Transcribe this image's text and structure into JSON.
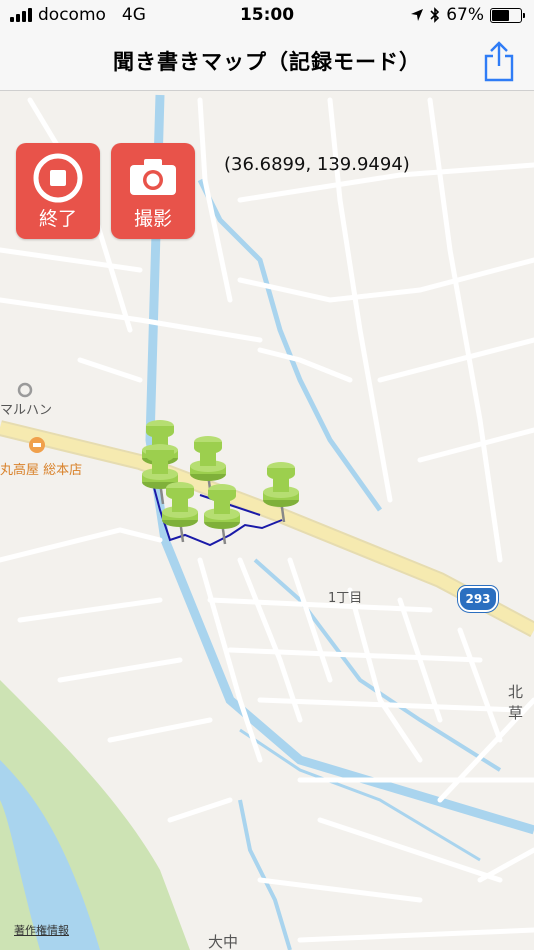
{
  "status_bar": {
    "carrier": "docomo",
    "network": "4G",
    "time": "15:00",
    "battery": "67%",
    "battery_level": 0.67,
    "icons": [
      "signal-icon",
      "location-arrow-icon",
      "bluetooth-icon",
      "battery-icon"
    ]
  },
  "nav": {
    "title": "聞き書きマップ（記録モード）",
    "share_icon": "share-icon"
  },
  "controls": {
    "stop_label": "終了",
    "stop_icon": "stop-icon",
    "photo_label": "撮影",
    "photo_icon": "camera-icon"
  },
  "map": {
    "coordinates": "(36.6899, 139.9494)",
    "labels": {
      "poi_maruhan": "マルハン",
      "poi_marutakaya": "丸高屋 総本店",
      "area_1chome": "1丁目",
      "area_kita": "北草",
      "area_onaka": "大中"
    },
    "route_number": "293",
    "attribution": "著作権情報",
    "pin_count": 6,
    "colors": {
      "accent_button": "#e8534a",
      "pin_green": "#9ccf4e",
      "track_blue": "#1a1aa8",
      "water": "#a9d4ee",
      "park": "#cde3b4",
      "road_yellow": "#f6eab0"
    }
  }
}
